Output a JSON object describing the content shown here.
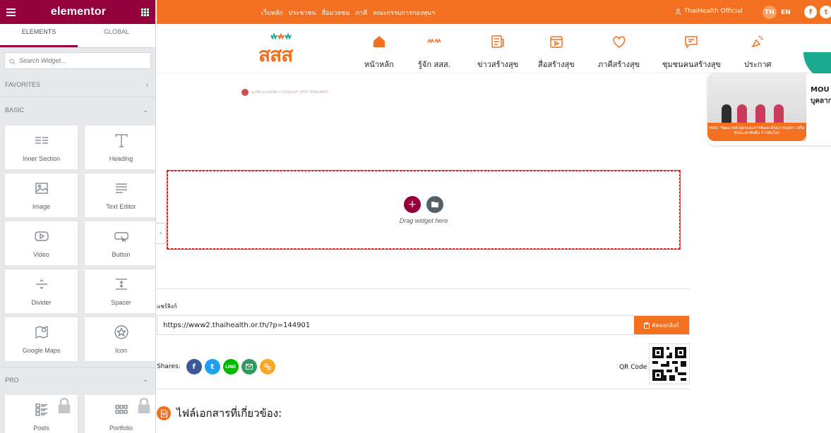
{
  "editor": {
    "logo": "elementor",
    "tabs": [
      "ELEMENTS",
      "GLOBAL"
    ],
    "search_placeholder": "Search Widget...",
    "categories": {
      "favorites": "FAVORITES",
      "basic": "BASIC",
      "pro": "PRO"
    },
    "basic_widgets": [
      {
        "label": "Inner Section",
        "icon": "inner-section-icon"
      },
      {
        "label": "Heading",
        "icon": "heading-icon"
      },
      {
        "label": "Image",
        "icon": "image-icon"
      },
      {
        "label": "Text Editor",
        "icon": "text-editor-icon"
      },
      {
        "label": "Video",
        "icon": "video-icon"
      },
      {
        "label": "Button",
        "icon": "button-icon"
      },
      {
        "label": "Divider",
        "icon": "divider-icon"
      },
      {
        "label": "Spacer",
        "icon": "spacer-icon"
      },
      {
        "label": "Google Maps",
        "icon": "map-icon"
      },
      {
        "label": "Icon",
        "icon": "star-icon"
      }
    ],
    "pro_widgets": [
      {
        "label": "Posts",
        "icon": "posts-icon",
        "locked": true
      },
      {
        "label": "Portfolio",
        "icon": "portfolio-icon",
        "locked": true
      }
    ]
  },
  "site": {
    "top_links": [
      "เว็บหลัก",
      "ประชาชน",
      "สื่อมวลชน",
      "ภาคี",
      "คณะกรรมการกองทุนฯ"
    ],
    "account": "ThaiHealth Official",
    "lang_th": "TH",
    "lang_en": "EN",
    "logo_text": "สสส",
    "nav": [
      {
        "label": "หน้าหลัก",
        "icon": "home-icon"
      },
      {
        "label": "รู้จัก สสส.",
        "icon": "about-icon"
      },
      {
        "label": "ข่าวสร้างสุข",
        "icon": "news-icon"
      },
      {
        "label": "สื่อสร้างสุข",
        "icon": "media-icon"
      },
      {
        "label": "ภาคีสร้างสุข",
        "icon": "heart-icon"
      },
      {
        "label": "ชุมชนคนสร้างสุข",
        "icon": "chat-icon"
      },
      {
        "label": "ประกาศ",
        "icon": "megaphone-icon"
      }
    ],
    "accent": "#f37021",
    "editor_accent": "#93003c"
  },
  "content": {
    "ash_logo_text": "มูลนิธิรณรงค์เพื่อการไม่สูบบุหรี่ (ASH THAILAND)",
    "news_card": {
      "title_line1": "MOU",
      "title_line2": "บุคลาก",
      "banner": "MOU \"พัฒนาหลักสูตรและการพัฒนาศักยภาพบุคลา เสริมทักษะเท่าทันสื่อ ก้าวทันโลก"
    },
    "dropzone_hint": "Drag widget here",
    "share_label": "แชร์ลิงก์",
    "share_url": "https://www2.thaihealth.or.th/?p=144901",
    "copy_button": "คัดลอกลิงก์",
    "shares_label": "Shares:",
    "line_label": "LINE",
    "qr_label": "QR Code :",
    "files_title": "ไฟล์เอกสารที่เกี่ยวข้อง:"
  }
}
